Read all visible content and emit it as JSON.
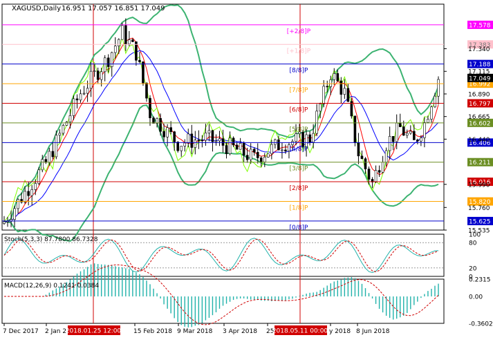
{
  "chart_data": [
    {
      "type": "candlestick",
      "title": "XAGUSD,Daily",
      "ohlc_label": "16.951 17.057 16.851 17.049",
      "price_axis_ticks": [
        "17.340",
        "17.115",
        "16.890",
        "16.665",
        "16.440",
        "15.990",
        "15.760",
        "15.535"
      ],
      "date_labels": [
        "7 Dec 2017",
        "2 Jan 2",
        "15 Feb 2018",
        "9 Mar 2018",
        "3 Apr 2018",
        "25",
        "y 2018",
        "8 Jun 2018"
      ],
      "marked_dates": [
        "2018.01.25 12:00",
        "2018.05.11 00:00"
      ],
      "current_price": {
        "label": "17.049",
        "value": 17.049
      },
      "murrey_levels": [
        {
          "label": "[+2/8]P",
          "price_label": "17.578",
          "value": 17.578,
          "color": "#ff00ff"
        },
        {
          "label": "[+1/8]P",
          "price_label": "17.383",
          "value": 17.383,
          "color": "#ffc0cb"
        },
        {
          "label": "[8/8]P",
          "price_label": "17.188",
          "value": 17.188,
          "color": "#0000cc"
        },
        {
          "label": "[7/8]P",
          "price_label": "16.992",
          "value": 16.992,
          "color": "#ffa500"
        },
        {
          "label": "[6/8]P",
          "price_label": "16.797",
          "value": 16.797,
          "color": "#d00000"
        },
        {
          "label": "[5/8]P",
          "price_label": "16.602",
          "value": 16.602,
          "color": "#6b8e23"
        },
        {
          "label": "[4/8]P",
          "price_label": "16.406",
          "value": 16.406,
          "color": "#0000cc"
        },
        {
          "label": "[3/8]P",
          "price_label": "16.211",
          "value": 16.211,
          "color": "#6b8e23"
        },
        {
          "label": "[2/8]P",
          "price_label": "16.016",
          "value": 16.016,
          "color": "#d00000"
        },
        {
          "label": "[1/8]P",
          "price_label": "15.820",
          "value": 15.82,
          "color": "#ffa500"
        },
        {
          "label": "[0/8]P",
          "price_label": "15.625",
          "value": 15.625,
          "color": "#0000cc"
        }
      ],
      "ylim": [
        15.535,
        17.66
      ],
      "grid": false
    },
    {
      "type": "line",
      "title": "Stoch(5,3,3) 87.7800 86.7328",
      "ticks": [
        "100",
        "80",
        "20",
        "0"
      ],
      "levels": [
        20,
        80
      ],
      "ylim": [
        0,
        100
      ],
      "series": [
        {
          "name": "Main",
          "color": "#20b2aa"
        },
        {
          "name": "Signal",
          "color": "#d00000"
        }
      ]
    },
    {
      "type": "bar",
      "title": "MACD(12,26,9) 0.1241 0.0384",
      "ticks": [
        "0.2315",
        "0.00",
        "-0.3602"
      ],
      "ylim": [
        -0.3602,
        0.2315
      ],
      "series": [
        {
          "name": "MACD",
          "color": "#20b2aa"
        },
        {
          "name": "Signal",
          "color": "#d00000"
        }
      ]
    }
  ]
}
